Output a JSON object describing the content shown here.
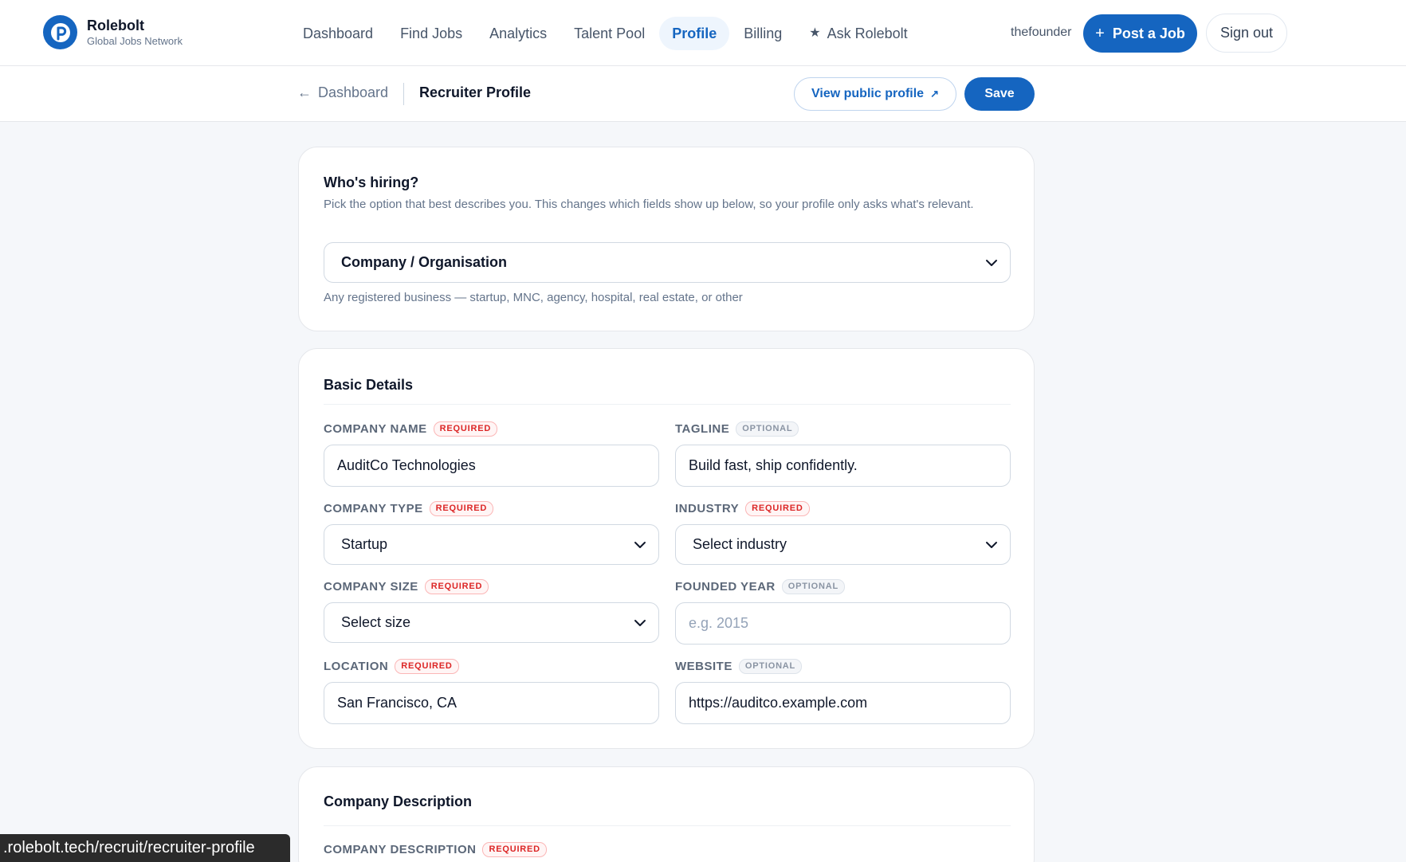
{
  "app": {
    "name": "Rolebolt",
    "subtitle": "Global Jobs Network"
  },
  "nav": {
    "items": [
      {
        "label": "Dashboard"
      },
      {
        "label": "Find Jobs"
      },
      {
        "label": "Analytics"
      },
      {
        "label": "Talent Pool"
      },
      {
        "label": "Profile",
        "active": true
      },
      {
        "label": "Billing"
      },
      {
        "label": "Ask Rolebolt",
        "icon": "star-icon"
      }
    ],
    "username": "thefounder",
    "post_job": "Post a Job",
    "sign_out": "Sign out"
  },
  "subheader": {
    "back_label": "Dashboard",
    "title": "Recruiter Profile",
    "view_public": "View public profile",
    "save": "Save"
  },
  "hiring": {
    "title": "Who's hiring?",
    "description": "Pick the option that best describes you. This changes which fields show up below, so your profile only asks what's relevant.",
    "selected": "Company / Organisation",
    "hint": "Any registered business — startup, MNC, agency, hospital, real estate, or other"
  },
  "basic_details": {
    "title": "Basic Details",
    "badges": {
      "required": "REQUIRED",
      "optional": "OPTIONAL"
    },
    "company_name": {
      "label": "COMPANY NAME",
      "value": "AuditCo Technologies"
    },
    "tagline": {
      "label": "TAGLINE",
      "value": "Build fast, ship confidently."
    },
    "company_type": {
      "label": "COMPANY TYPE",
      "value": "Startup"
    },
    "industry": {
      "label": "INDUSTRY",
      "value": "Select industry"
    },
    "company_size": {
      "label": "COMPANY SIZE",
      "value": "Select size"
    },
    "founded_year": {
      "label": "FOUNDED YEAR",
      "value": "",
      "placeholder": "e.g. 2015"
    },
    "location": {
      "label": "LOCATION",
      "value": "San Francisco, CA"
    },
    "website": {
      "label": "WEBSITE",
      "value": "https://auditco.example.com"
    }
  },
  "company_description": {
    "title": "Company Description",
    "field_label": "COMPANY DESCRIPTION"
  },
  "status_url": ".rolebolt.tech/recruit/recruiter-profile",
  "colors": {
    "accent": "#1565c0",
    "required": "#dc2626",
    "background": "#f5f7fa"
  }
}
